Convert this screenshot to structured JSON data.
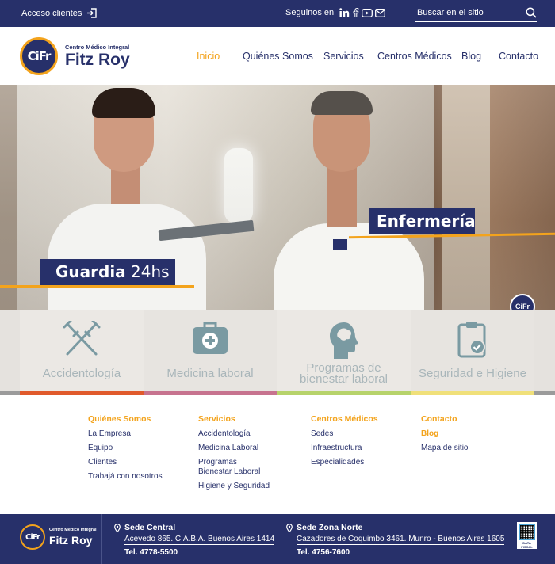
{
  "topbar": {
    "access_label": "Acceso clientes",
    "follow_label": "Seguinos en",
    "social_icons": [
      "linkedin-icon",
      "facebook-icon",
      "youtube-icon",
      "mail-icon"
    ],
    "search_placeholder": "Buscar en el sitio"
  },
  "brand": {
    "tagline": "Centro Médico Integral",
    "name": "Fitz Roy",
    "monogram": "CiFr"
  },
  "nav": {
    "items": [
      "Inicio",
      "Quiénes Somos",
      "Servicios",
      "Centros Médicos",
      "Blog",
      "Contacto"
    ],
    "active": "Inicio"
  },
  "hero": {
    "tag1_bold": "Guardia",
    "tag1_light": "24hs",
    "tag2": "Enfermería"
  },
  "services": [
    {
      "label": "Accidentología",
      "icon": "crutches-icon",
      "color": "#e05a2b"
    },
    {
      "label": "Medicina laboral",
      "icon": "first-aid-kit-icon",
      "color": "#c7738f"
    },
    {
      "label": "Programas de bienestar laboral",
      "line1": "Programas de",
      "line2": "bienestar laboral",
      "icon": "head-brain-icon",
      "color": "#b7d36b"
    },
    {
      "label": "Seguridad e Higiene",
      "icon": "clipboard-check-icon",
      "color": "#f0e07a"
    }
  ],
  "footer_links": {
    "col1": {
      "title": "Quiénes Somos",
      "items": [
        "La Empresa",
        "Equipo",
        "Clientes",
        "Trabajá con nosotros"
      ]
    },
    "col2": {
      "title": "Servicios",
      "items": [
        "Accidentología",
        "Medicina Laboral",
        "Programas Bienestar Laboral",
        "Higiene y Seguridad"
      ]
    },
    "col3": {
      "title": "Centros Médicos",
      "items": [
        "Sedes",
        "Infraestructura",
        "Especialidades"
      ]
    },
    "col4": {
      "title": "Contacto",
      "blog": "Blog",
      "items": [
        "Mapa de sitio"
      ]
    }
  },
  "footer": {
    "sede_central": {
      "title": "Sede Central",
      "address": "Acevedo 865. C.A.B.A. Buenos Aires 1414",
      "tel": "Tel. 4778-5500"
    },
    "sede_norte": {
      "title": "Sede Zona Norte",
      "address": "Cazadores de Coquimbo 3461. Munro - Buenos Aires 1605",
      "tel": "Tel. 4756-7600"
    },
    "data_fiscal": "DATA FISCAL"
  },
  "colors": {
    "navy": "#27306a",
    "orange": "#f3a31c",
    "service_text": "#a9b6ba"
  }
}
